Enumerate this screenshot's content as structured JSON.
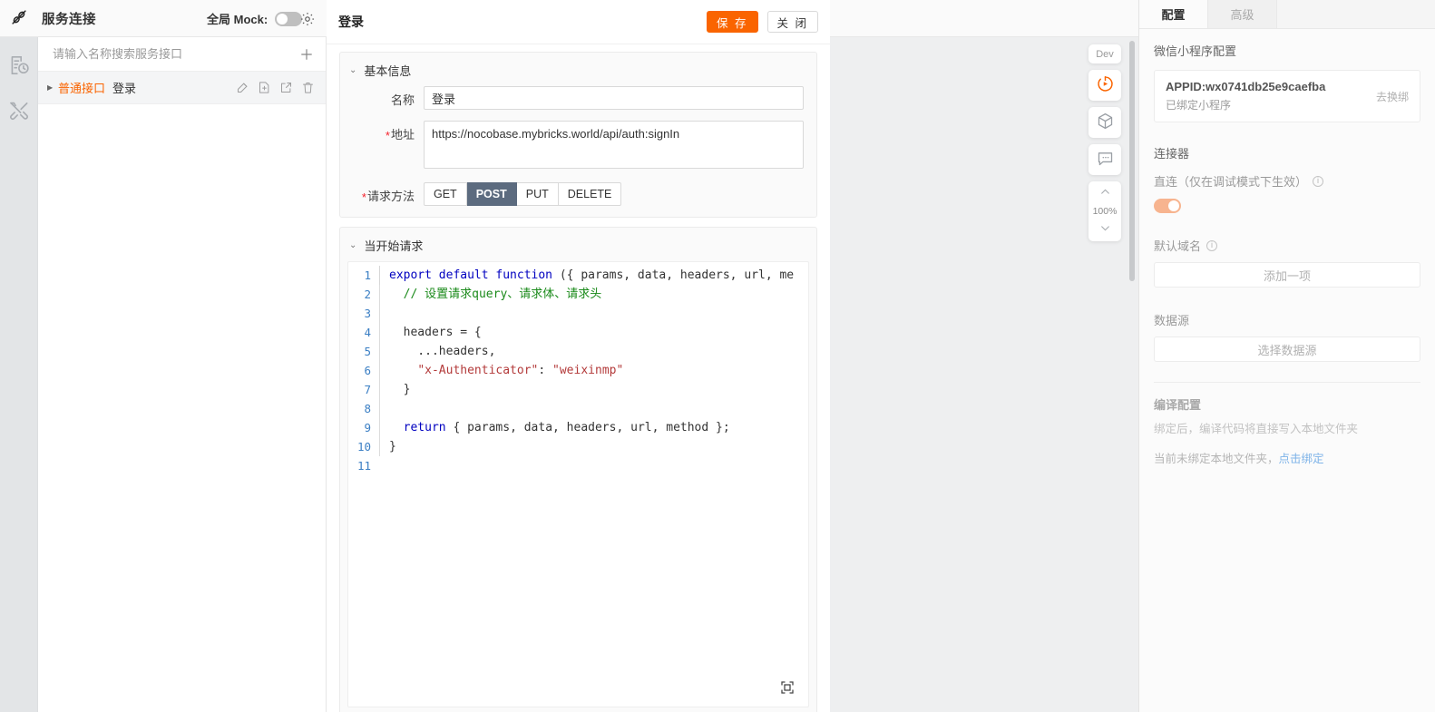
{
  "topbar": {
    "logo_icon": "link-chain-icon",
    "title": "服务连接",
    "mock_label": "全局 Mock:",
    "mock_enabled": false,
    "settings_icon": "gear-icon"
  },
  "rail": {
    "items": [
      {
        "icon": "document-clock-icon",
        "name": "history"
      },
      {
        "icon": "tools-icon",
        "name": "tools"
      }
    ]
  },
  "service_list": {
    "search_placeholder": "请输入名称搜索服务接口",
    "search_value": "",
    "add_icon": "plus-icon",
    "rows": [
      {
        "type_label": "普通接口",
        "name": "登录",
        "caret": "▶",
        "actions": [
          "edit-icon",
          "duplicate-icon",
          "open-external-icon",
          "delete-icon"
        ]
      }
    ]
  },
  "editor_header": {
    "title": "登录",
    "save_label": "保 存",
    "close_label": "关 闭"
  },
  "basic_section": {
    "chevron": "⌄",
    "title": "基本信息",
    "name_label": "名称",
    "name_value": "登录",
    "url_label": "地址",
    "url_value": "https://nocobase.mybricks.world/api/auth:signIn",
    "method_label": "请求方法",
    "methods": [
      "GET",
      "POST",
      "PUT",
      "DELETE"
    ],
    "method_selected": "POST"
  },
  "code_section": {
    "chevron": "⌄",
    "title": "当开始请求",
    "fullscreen_icon": "fullscreen-icon",
    "lines": [
      {
        "no": "1",
        "tokens": [
          {
            "t": "kw",
            "s": "export default function "
          },
          {
            "t": "pl",
            "s": "({ params, data, headers, url, me"
          }
        ]
      },
      {
        "no": "2",
        "tokens": [
          {
            "t": "pl",
            "s": "  "
          },
          {
            "t": "cmt",
            "s": "// 设置请求query、请求体、请求头"
          }
        ]
      },
      {
        "no": "3",
        "tokens": []
      },
      {
        "no": "4",
        "tokens": [
          {
            "t": "pl",
            "s": "  headers = {"
          }
        ]
      },
      {
        "no": "5",
        "tokens": [
          {
            "t": "pl",
            "s": "    ...headers,"
          }
        ]
      },
      {
        "no": "6",
        "tokens": [
          {
            "t": "pl",
            "s": "    "
          },
          {
            "t": "str",
            "s": "\"x-Authenticator\""
          },
          {
            "t": "pl",
            "s": ": "
          },
          {
            "t": "str",
            "s": "\"weixinmp\""
          }
        ]
      },
      {
        "no": "7",
        "tokens": [
          {
            "t": "pl",
            "s": "  }"
          }
        ]
      },
      {
        "no": "8",
        "tokens": []
      },
      {
        "no": "9",
        "tokens": [
          {
            "t": "pl",
            "s": "  "
          },
          {
            "t": "kw",
            "s": "return"
          },
          {
            "t": "pl",
            "s": " { params, data, headers, url, method };"
          }
        ]
      },
      {
        "no": "10",
        "tokens": [
          {
            "t": "pl",
            "s": "}"
          }
        ]
      },
      {
        "no": "11",
        "tokens": []
      }
    ]
  },
  "canvas_tools": {
    "dev_label": "Dev",
    "run_icon": "play-circle-icon",
    "cube_icon": "cube-icon",
    "comment_icon": "comment-icon",
    "zoom_up_icon": "chevron-up-icon",
    "zoom_level": "100%",
    "zoom_down_icon": "chevron-down-icon"
  },
  "right_panel": {
    "tabs": [
      {
        "label": "配置",
        "active": true
      },
      {
        "label": "高级",
        "active": false
      }
    ],
    "wechat_section_title": "微信小程序配置",
    "appid_text": "APPID:wx0741db25e9caefba",
    "appid_status": "已绑定小程序",
    "rebind_label": "去换绑",
    "connector_title": "连接器",
    "direct_label": "直连（仅在调试模式下生效）",
    "direct_info_icon": "info-icon",
    "direct_enabled": true,
    "domain_label": "默认域名",
    "domain_info_icon": "info-icon",
    "add_item_label": "添加一项",
    "datasource_label": "数据源",
    "select_datasource_label": "选择数据源",
    "compile_title": "编译配置",
    "compile_desc": "绑定后，编译代码将直接写入本地文件夹",
    "compile_note_prefix": "当前未绑定本地文件夹，",
    "compile_note_link": "点击绑定"
  },
  "colors": {
    "accent": "#fa6400",
    "method_active_bg": "#5c6b7f",
    "link": "#7eb3e8",
    "canvas_bg": "#eeeff0"
  }
}
